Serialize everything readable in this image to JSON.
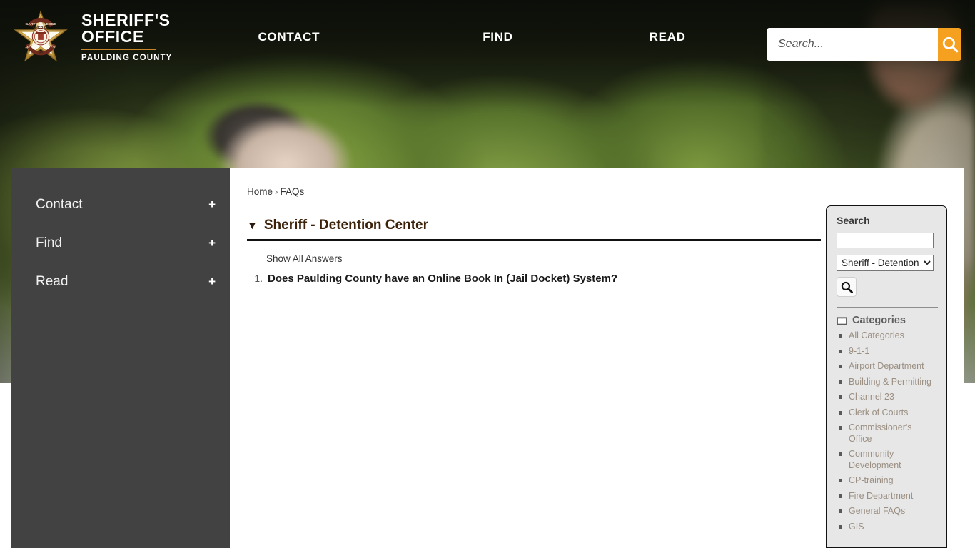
{
  "brand": {
    "line1": "SHERIFF'S",
    "line2": "OFFICE",
    "line3": "PAULDING COUNTY",
    "badge_top_text": "GARY GULLEDGE",
    "badge_mid_text": "SHERIFF",
    "badge_left_text": "PAULDING",
    "badge_right_text": "COUNTY",
    "badge_bottom_text": "GA",
    "accent_color": "#c8862a"
  },
  "nav": {
    "items": [
      {
        "label": "CONTACT"
      },
      {
        "label": "FIND"
      },
      {
        "label": "READ"
      }
    ]
  },
  "header_search": {
    "placeholder": "Search...",
    "value": "",
    "button_icon": "search-icon",
    "button_color": "#f5a01e"
  },
  "sidebar": {
    "items": [
      {
        "label": "Contact",
        "expander": "+"
      },
      {
        "label": "Find",
        "expander": "+"
      },
      {
        "label": "Read",
        "expander": "+"
      }
    ]
  },
  "breadcrumb": {
    "home": "Home",
    "separator": "›",
    "current": "FAQs"
  },
  "faq": {
    "caret": "▼",
    "title": "Sheriff - Detention Center",
    "show_all_label": "Show All Answers",
    "questions": [
      {
        "num": "1.",
        "text": "Does Paulding County have an Online Book In (Jail Docket) System?"
      }
    ]
  },
  "widget": {
    "title": "Search",
    "input_value": "",
    "select_value": "Sheriff - Detention Center",
    "go_icon": "search-icon",
    "categories_icon": "categories-icon",
    "categories_title": "Categories",
    "categories": [
      "All Categories",
      "9-1-1",
      "Airport Department",
      "Building & Permitting",
      "Channel 23",
      "Clerk of Courts",
      "Commissioner's Office",
      "Community Development",
      "CP-training",
      "Fire Department",
      "General FAQs",
      "GIS"
    ]
  }
}
